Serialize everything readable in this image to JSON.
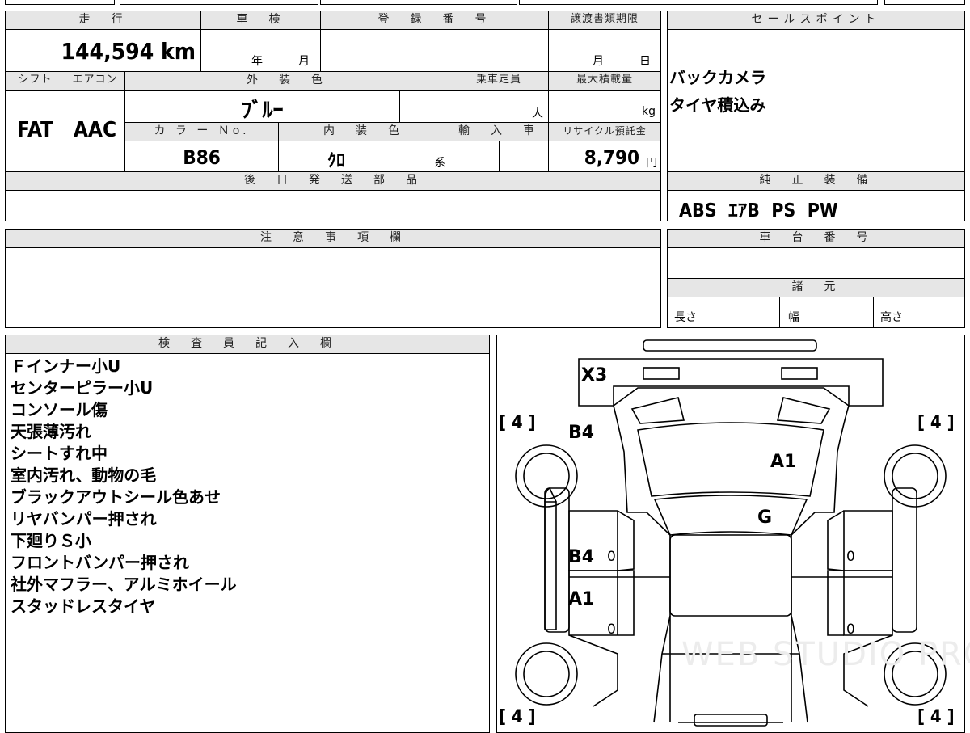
{
  "top_table": {
    "mileage_label": "走　行",
    "mileage_value": "144,594 km",
    "inspection_label": "車　検",
    "inspection_year": "年",
    "inspection_month": "月",
    "registration_label": "登　録　番　号",
    "transfer_deadline_label": "譲渡書類期限",
    "transfer_month": "月",
    "transfer_day": "日",
    "shift_label": "シフト",
    "shift_value": "FAT",
    "aircon_label": "エアコン",
    "aircon_value": "AAC",
    "exterior_label": "外　装　色",
    "exterior_value": "ﾌﾞﾙｰ",
    "capacity_label": "乗車定員",
    "capacity_unit": "人",
    "max_load_label": "最大積載量",
    "max_load_unit": "kg",
    "color_no_label": "カ ラ ー Ｎo.",
    "color_no_value": "B86",
    "interior_label": "内　装　色",
    "interior_value": "ｸﾛ",
    "interior_suffix": "系",
    "import_label": "輸　入　車",
    "recycle_label": "リサイクル預託金",
    "recycle_value": "8,790",
    "recycle_unit": "円",
    "later_parts_label": "後　日　発　送　部　品"
  },
  "sales_points": {
    "label": "セールスポイント",
    "items": [
      "バックカメラ",
      "タイヤ積込み"
    ]
  },
  "equipment": {
    "label": "純　正　装　備",
    "value": "ABS  ｴｱB  PS  PW"
  },
  "notes": {
    "label": "注　意　事　項　欄"
  },
  "chassis": {
    "label": "車　台　番　号",
    "specs_label": "諸　元",
    "length_label": "長さ",
    "width_label": "幅",
    "height_label": "高さ"
  },
  "inspector": {
    "label": "検　査　員　記　入　欄",
    "lines": [
      "Ｆインナー小U",
      "センターピラー小U",
      "コンソール傷",
      "天張薄汚れ",
      "シートすれ中",
      "室内汚れ、動物の毛",
      "ブラックアウトシール色あせ",
      "リヤバンパー押され",
      "下廻りＳ小",
      "フロントバンパー押され",
      "社外マフラー、アルミホイール",
      "スタッドレスタイヤ"
    ]
  },
  "diagram": {
    "marks": {
      "front_bumper": "X3",
      "fender_fl": "B4",
      "hood": "A1",
      "windshield": "G",
      "door_fl": "B4",
      "door_rl": "A1",
      "tire_fl": "[ 4 ]",
      "tire_fr": "[ 4 ]",
      "tire_rl": "[ 4 ]",
      "tire_rr": "[ 4 ]",
      "door_fl_zero": "0",
      "door_rl_zero": "0",
      "door_fr_zero": "0",
      "door_rr_zero": "0"
    },
    "watermark": "WEB STUDIO PRO"
  }
}
